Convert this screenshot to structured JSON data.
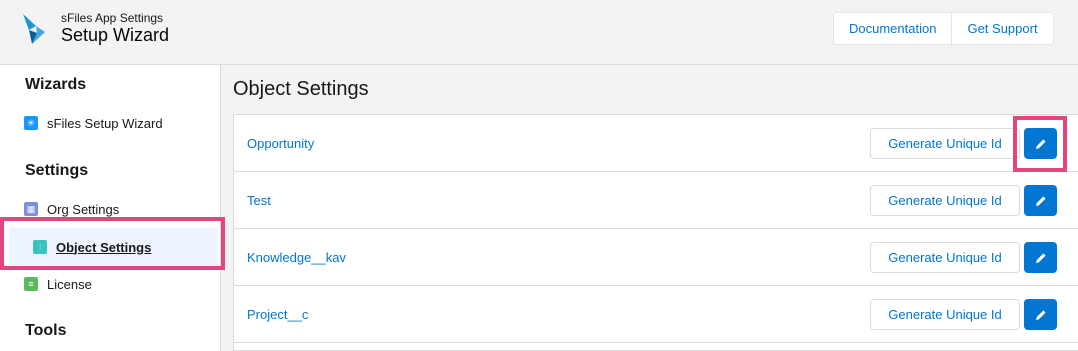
{
  "header": {
    "subtitle": "sFiles App Settings",
    "title": "Setup Wizard",
    "buttons": {
      "documentation": "Documentation",
      "support": "Get Support"
    }
  },
  "sidebar": {
    "sections": [
      {
        "title": "Wizards",
        "items": [
          {
            "label": "sFiles Setup Wizard",
            "icon": "wizard-icon"
          }
        ]
      },
      {
        "title": "Settings",
        "items": [
          {
            "label": "Org Settings",
            "icon": "org-settings-icon"
          },
          {
            "label": "Object Settings",
            "icon": "object-settings-icon",
            "active": true
          },
          {
            "label": "License",
            "icon": "license-icon"
          }
        ]
      },
      {
        "title": "Tools",
        "items": []
      }
    ]
  },
  "main": {
    "title": "Object Settings",
    "rows": [
      {
        "name": "Opportunity",
        "action": "Generate Unique Id"
      },
      {
        "name": "Test",
        "action": "Generate Unique Id"
      },
      {
        "name": "Knowledge__kav",
        "action": "Generate Unique Id"
      },
      {
        "name": "Project__c",
        "action": "Generate Unique Id"
      }
    ]
  },
  "colors": {
    "accent": "#0176d3",
    "highlight": "#e3457e",
    "active_bg": "#eef4ff"
  }
}
